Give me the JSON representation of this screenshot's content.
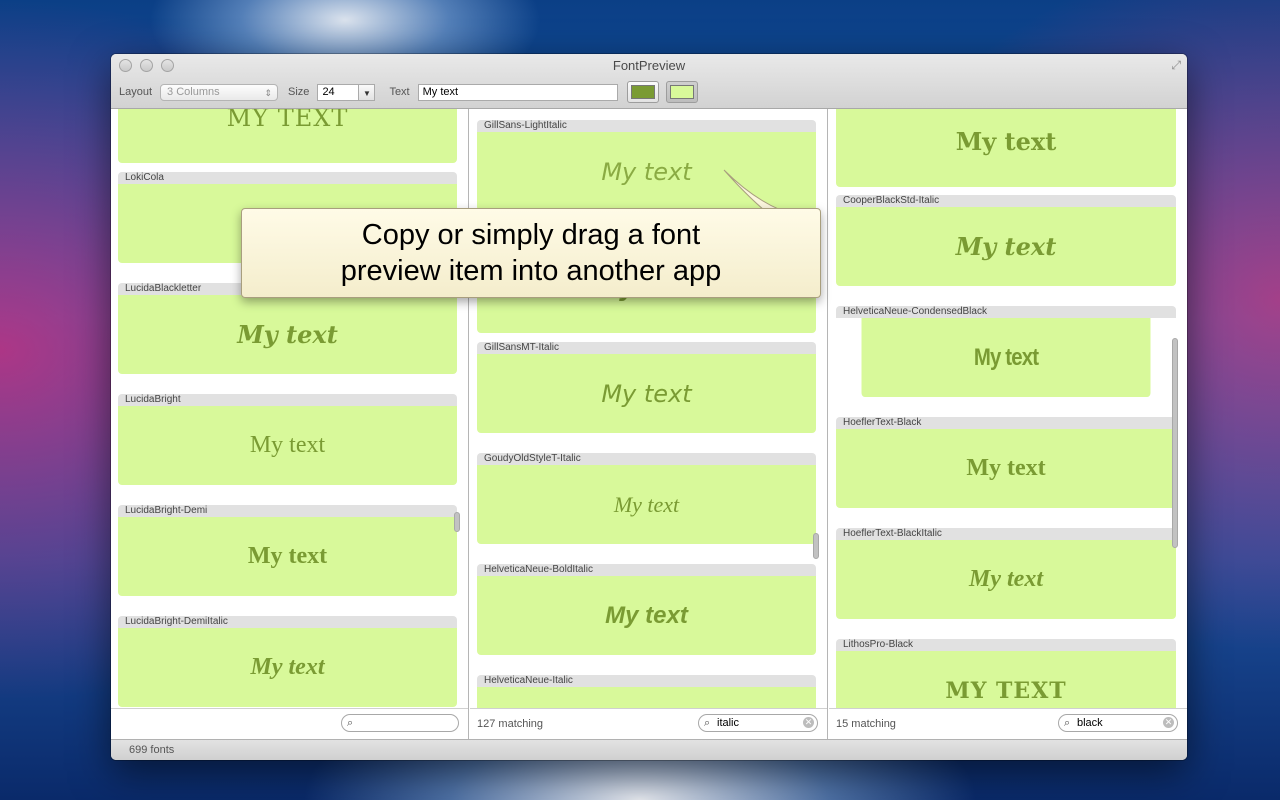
{
  "window": {
    "title": "FontPreview"
  },
  "toolbar": {
    "layout_label": "Layout",
    "layout_value": "3 Columns",
    "size_label": "Size",
    "size_value": "24",
    "text_label": "Text",
    "text_value": "My text",
    "foreground_color": "#7a9b33",
    "background_color": "#d8f99a"
  },
  "columns": [
    {
      "items": [
        {
          "name": "",
          "preview": "MY TEXT"
        },
        {
          "name": "LokiCola",
          "preview": ""
        },
        {
          "name": "LucidaBlackletter",
          "preview": "My text"
        },
        {
          "name": "LucidaBright",
          "preview": "My text"
        },
        {
          "name": "LucidaBright-Demi",
          "preview": "My text"
        },
        {
          "name": "LucidaBright-DemiItalic",
          "preview": "My text"
        }
      ],
      "count": "",
      "search": ""
    },
    {
      "items": [
        {
          "name": "GillSans-LightItalic",
          "preview": "My text"
        },
        {
          "name": "",
          "preview": "My text"
        },
        {
          "name": "GillSansMT-Italic",
          "preview": "My text"
        },
        {
          "name": "GoudyOldStyleT-Italic",
          "preview": "My text"
        },
        {
          "name": "HelveticaNeue-BoldItalic",
          "preview": "My text"
        },
        {
          "name": "HelveticaNeue-Italic",
          "preview": ""
        }
      ],
      "count": "127 matching",
      "search": "italic"
    },
    {
      "items": [
        {
          "name": "",
          "preview": "My text"
        },
        {
          "name": "CooperBlackStd-Italic",
          "preview": "My text"
        },
        {
          "name": "HelveticaNeue-CondensedBlack",
          "preview": "My text"
        },
        {
          "name": "HoeflerText-Black",
          "preview": "My text"
        },
        {
          "name": "HoeflerText-BlackItalic",
          "preview": "My text"
        },
        {
          "name": "LithosPro-Black",
          "preview": "MY TEXT"
        }
      ],
      "count": "15 matching",
      "search": "black"
    }
  ],
  "status": {
    "font_count": "699 fonts"
  },
  "callout": {
    "text": "Copy or simply drag a font\npreview item into another app"
  }
}
